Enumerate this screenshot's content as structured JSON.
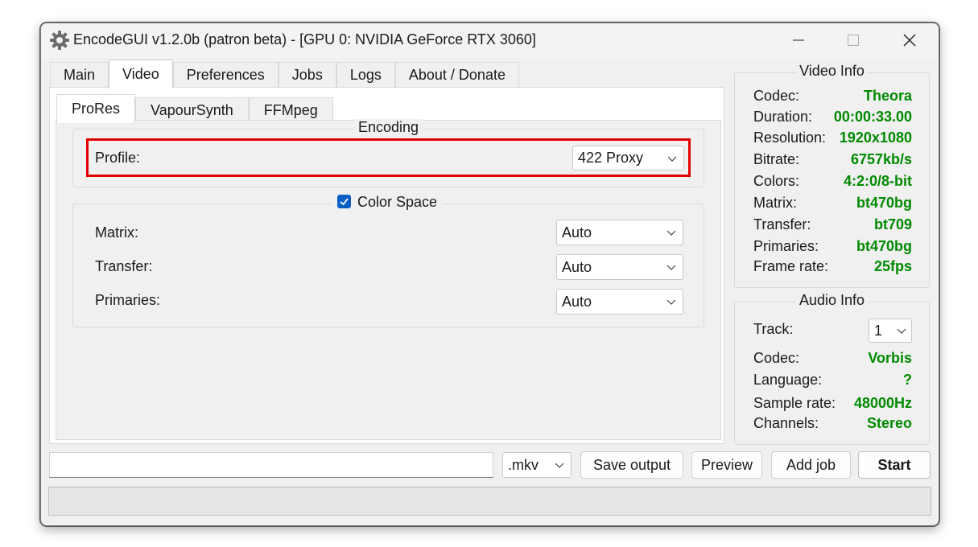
{
  "window": {
    "title": "EncodeGUI v1.2.0b (patron beta) - [GPU 0: NVIDIA GeForce RTX 3060]",
    "icon": "gear-icon",
    "controls": [
      "minimize-icon",
      "maximize-icon",
      "close-icon"
    ]
  },
  "main_tabs": [
    {
      "label": "Main",
      "active": false
    },
    {
      "label": "Video",
      "active": true
    },
    {
      "label": "Preferences",
      "active": false
    },
    {
      "label": "Jobs",
      "active": false
    },
    {
      "label": "Logs",
      "active": false
    },
    {
      "label": "About / Donate",
      "active": false
    }
  ],
  "sub_tabs": [
    {
      "label": "ProRes",
      "active": true
    },
    {
      "label": "VapourSynth",
      "active": false
    },
    {
      "label": "FFMpeg",
      "active": false
    }
  ],
  "encoding": {
    "title": "Encoding",
    "profile_label": "Profile:",
    "profile_value": "422 Proxy"
  },
  "color_space": {
    "title": "Color Space",
    "checked": true,
    "matrix_label": "Matrix:",
    "matrix_value": "Auto",
    "transfer_label": "Transfer:",
    "transfer_value": "Auto",
    "primaries_label": "Primaries:",
    "primaries_value": "Auto"
  },
  "video_info": {
    "title": "Video Info",
    "rows": [
      {
        "label": "Codec:",
        "value": "Theora"
      },
      {
        "label": "Duration:",
        "value": "00:00:33.00"
      },
      {
        "label": "Resolution:",
        "value": "1920x1080"
      },
      {
        "label": "Bitrate:",
        "value": "6757kb/s"
      },
      {
        "label": "Colors:",
        "value": "4:2:0/8-bit"
      },
      {
        "label": "Matrix:",
        "value": "bt470bg"
      },
      {
        "label": "Transfer:",
        "value": "bt709"
      },
      {
        "label": "Primaries:",
        "value": "bt470bg"
      },
      {
        "label": "Frame rate:",
        "value": "25fps"
      }
    ]
  },
  "audio_info": {
    "title": "Audio Info",
    "track_label": "Track:",
    "track_value": "1",
    "rows": [
      {
        "label": "Codec:",
        "value": "Vorbis"
      },
      {
        "label": "Language:",
        "value": "?"
      },
      {
        "label": "Sample rate:",
        "value": "48000Hz"
      },
      {
        "label": "Channels:",
        "value": "Stereo"
      }
    ]
  },
  "bottom": {
    "output_path": "",
    "container_value": ".mkv",
    "save_output_label": "Save output",
    "preview_label": "Preview",
    "add_job_label": "Add job",
    "start_label": "Start"
  },
  "colors": {
    "value_green": "#008a00",
    "highlight_red": "#e00000",
    "checkbox_blue": "#0a5fc7"
  }
}
